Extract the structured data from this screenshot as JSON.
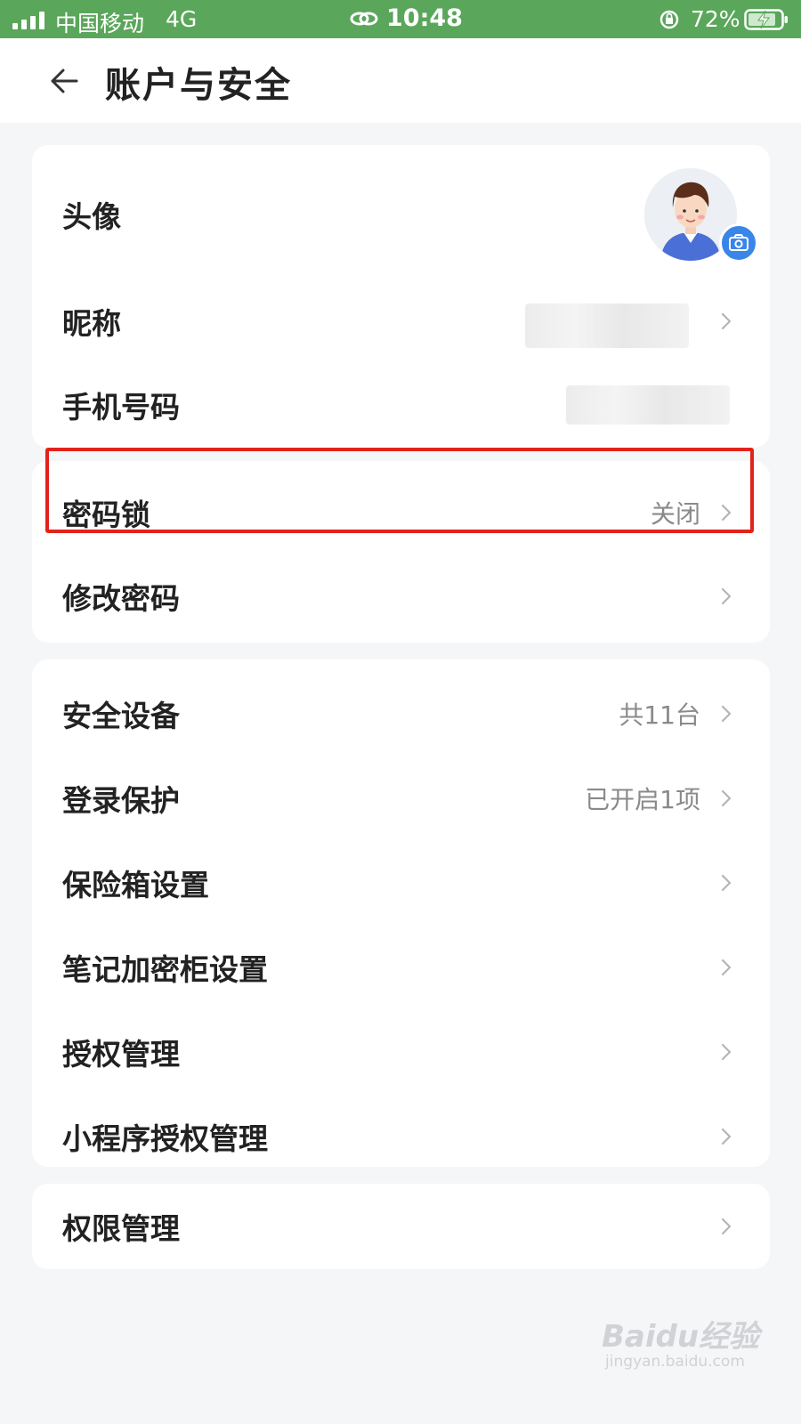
{
  "status_bar": {
    "carrier": "中国移动",
    "network": "4G",
    "time": "10:48",
    "battery": "72%"
  },
  "header": {
    "title": "账户与安全",
    "back_icon": "back-arrow-icon"
  },
  "profile_card": {
    "avatar_label": "头像",
    "nickname_label": "昵称",
    "phone_label": "手机号码"
  },
  "password_card": {
    "lock_label": "密码锁",
    "lock_value": "关闭",
    "change_label": "修改密码"
  },
  "security_card": {
    "devices_label": "安全设备",
    "devices_value": "共11台",
    "login_label": "登录保护",
    "login_value": "已开启1项",
    "safe_label": "保险箱设置",
    "note_label": "笔记加密柜设置",
    "auth_label": "授权管理",
    "mini_label": "小程序授权管理"
  },
  "permission_card": {
    "perm_label": "权限管理"
  },
  "watermark": {
    "main": "Baidu经验",
    "sub": "jingyan.baidu.com"
  },
  "colors": {
    "status_bar": "#5aa65a",
    "highlight": "#e2231a",
    "camera_badge": "#3a86e8"
  }
}
